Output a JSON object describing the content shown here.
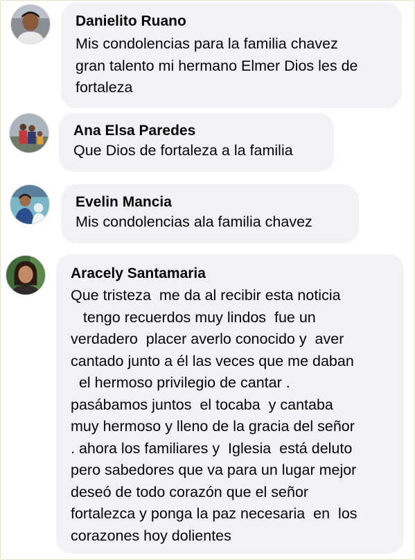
{
  "comments": [
    {
      "author": "Danielito Ruano",
      "text": "Mis condolencias para la familia chavez\ngran talento mi hermano Elmer Dios les de\nfortaleza"
    },
    {
      "author": "Ana Elsa Paredes",
      "text": "Que Dios de fortaleza a la familia"
    },
    {
      "author": "Evelin Mancia",
      "text": "Mis condolencias ala familia chavez"
    },
    {
      "author": "Aracely Santamaria",
      "text": "Que tristeza  me da al recibir esta noticia\n   tengo recuerdos muy lindos  fue un\nverdadero  placer averlo conocido y  aver\ncantado junto a él las veces que me daban\n  el hermoso privilegio de cantar .\npasábamos juntos  el tocaba  y cantaba\nmuy hermoso y lleno de la gracia del señor\n. ahora los familiares y  Iglesia  está deluto\npero sabedores que va para un lugar mejor\ndeseó de todo corazón que el señor\nfortalezca y ponga la paz necesaria  en  los\ncorazones hoy dolientes"
    }
  ]
}
